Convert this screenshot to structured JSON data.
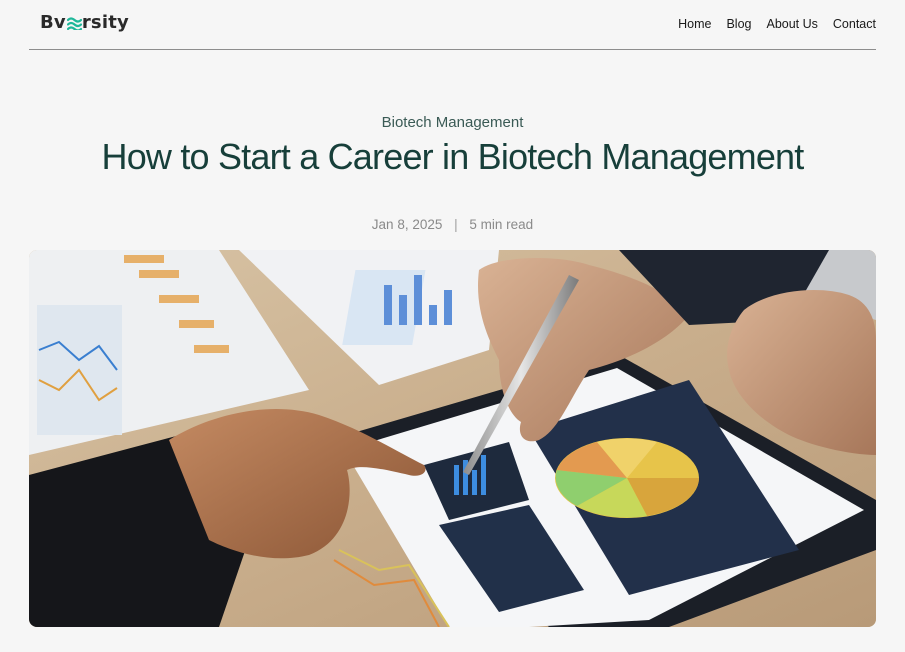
{
  "brand": {
    "name_part1": "Bv",
    "name_part2": "rsity",
    "accent_color": "#1fb89a"
  },
  "nav": {
    "items": [
      {
        "label": "Home"
      },
      {
        "label": "Blog"
      },
      {
        "label": "About Us"
      },
      {
        "label": "Contact"
      }
    ]
  },
  "article": {
    "category": "Biotech Management",
    "title": "How to Start a Career in Biotech Management",
    "date": "Jan 8, 2025",
    "separator": "|",
    "read_time": "5 min read"
  }
}
